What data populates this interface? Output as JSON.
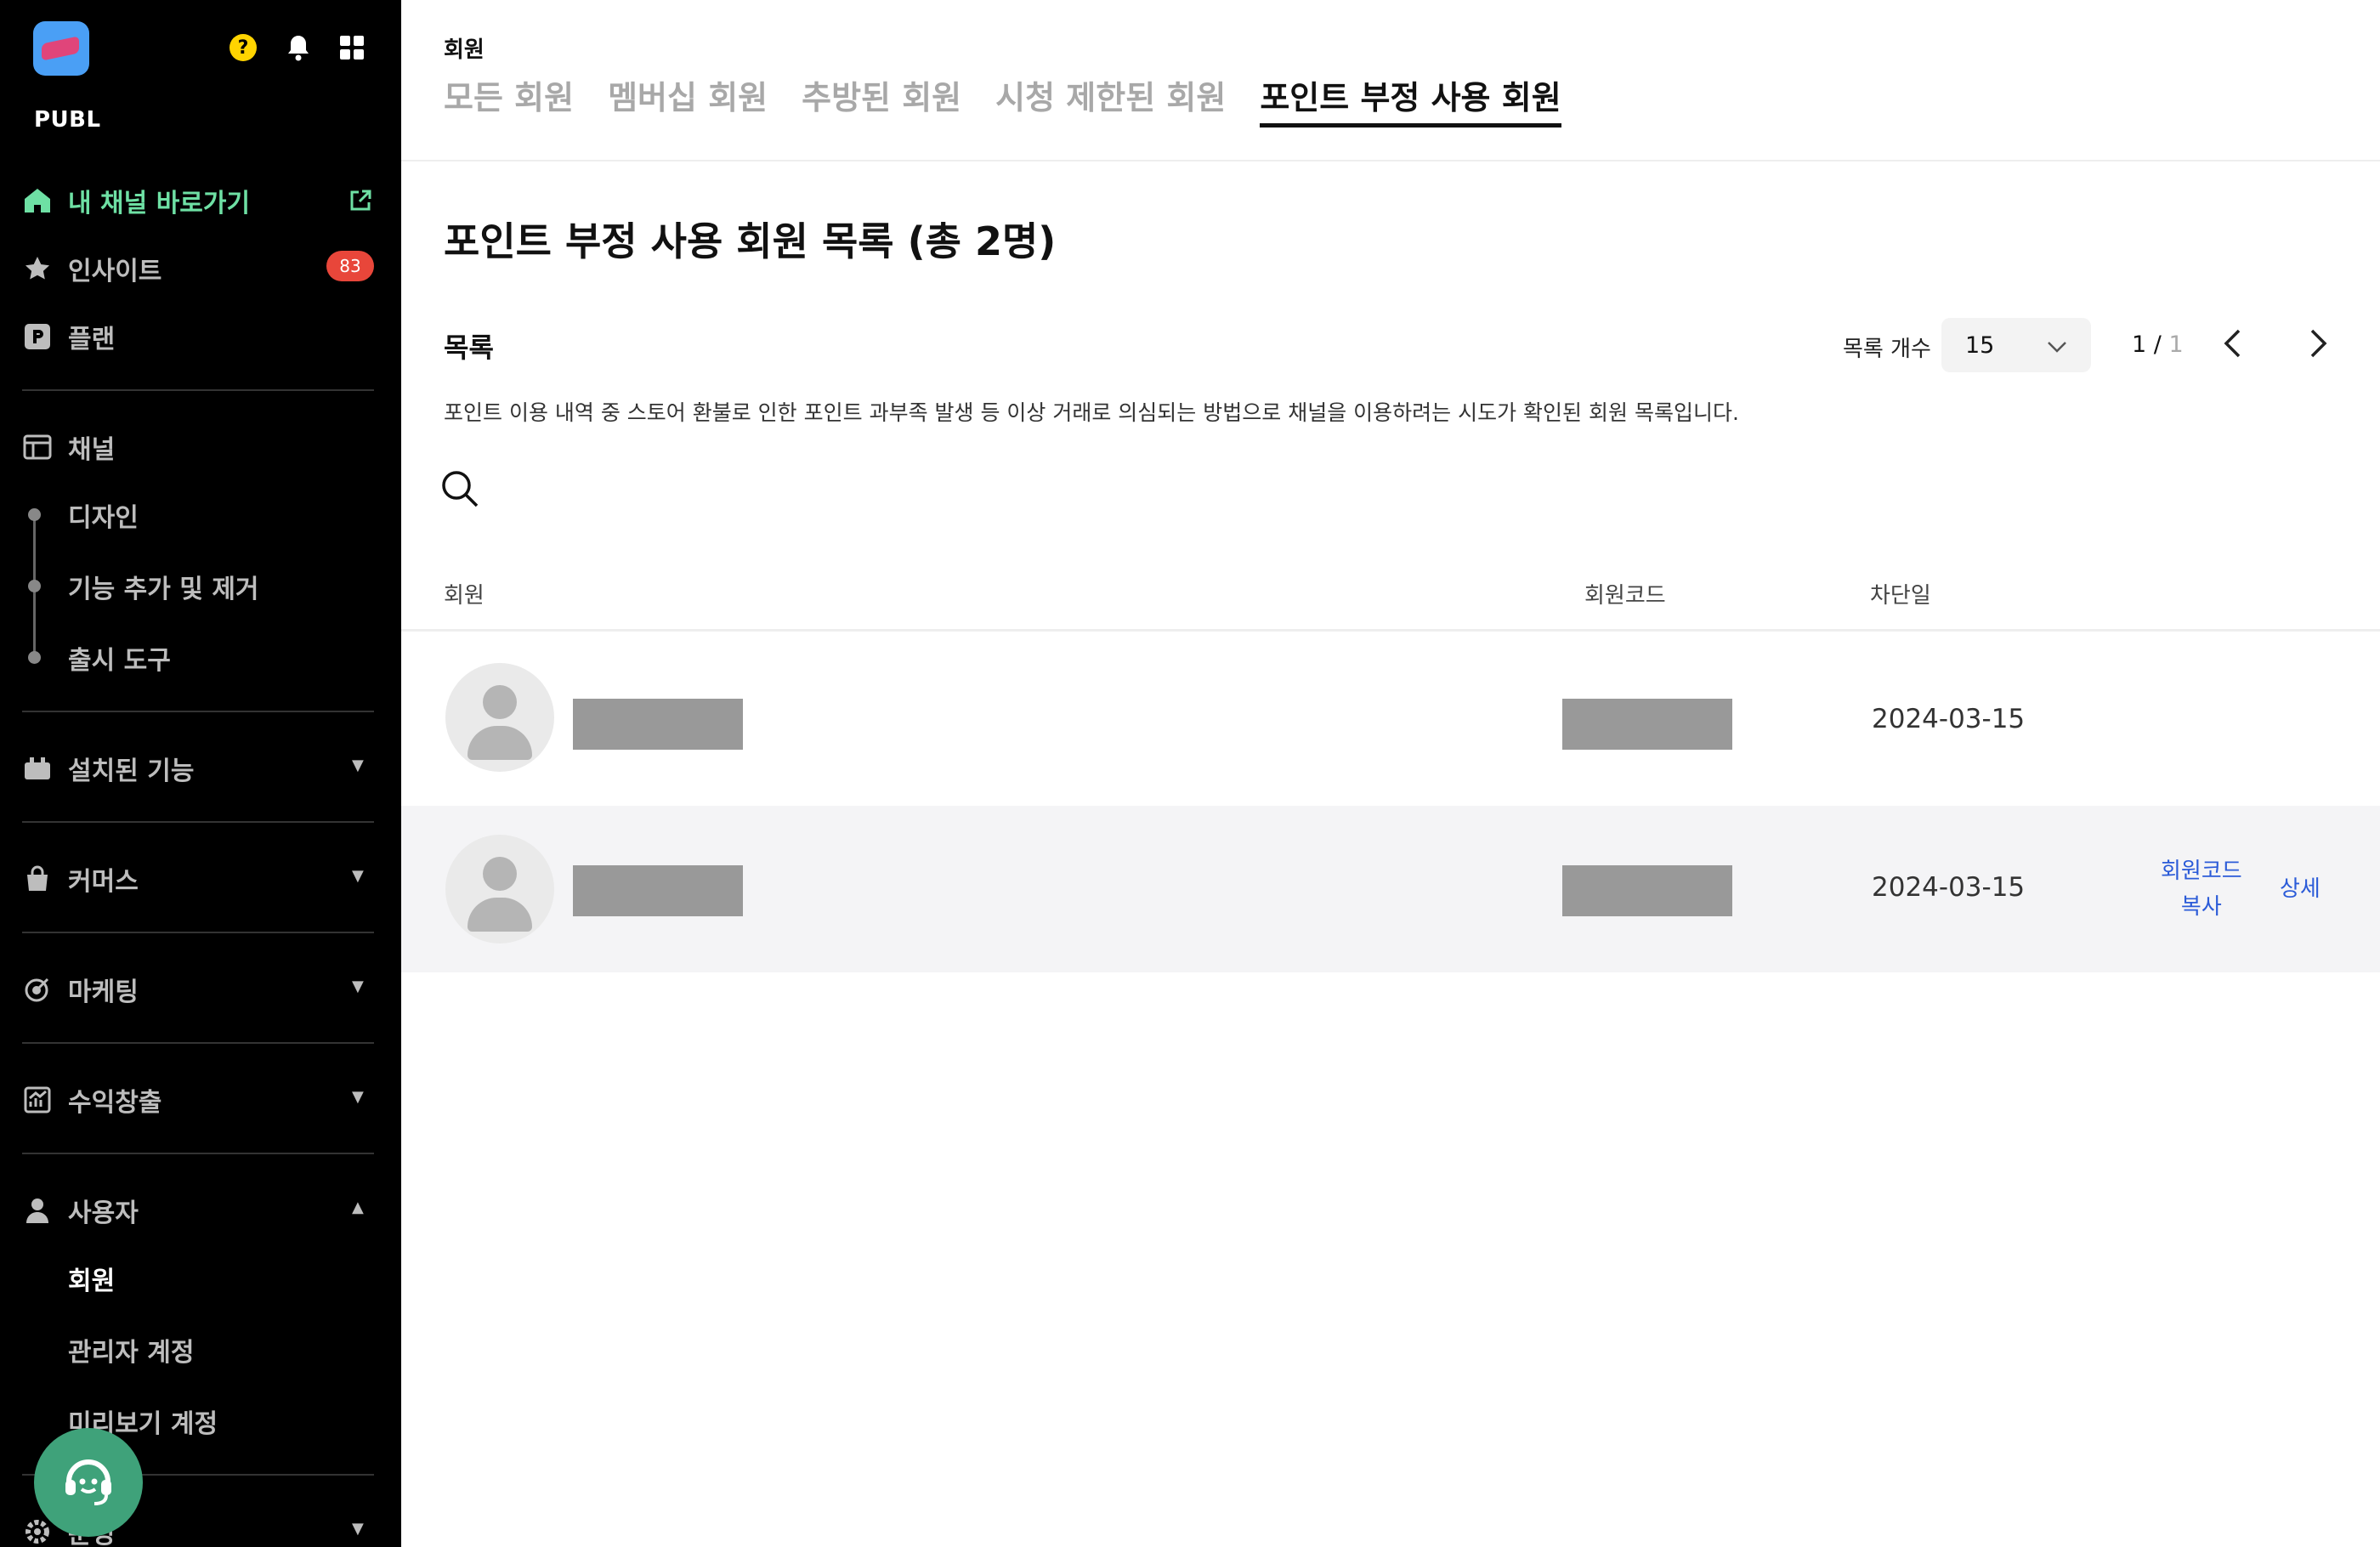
{
  "sidebar": {
    "brand": "PUBL",
    "help_glyph": "?",
    "badge_count": "83",
    "items": {
      "channel_shortcut": "내 채널 바로가기",
      "insight": "인사이트",
      "plan": "플랜",
      "channel": "채널",
      "design": "디자인",
      "feature_add_remove": "기능 추가 및 제거",
      "launch_tools": "출시 도구",
      "installed_features": "설치된 기능",
      "commerce": "커머스",
      "marketing": "마케팅",
      "monetization": "수익창출",
      "users": "사용자",
      "members": "회원",
      "admin_accounts": "관리자 계정",
      "preview_accounts": "미리보기 계정",
      "settings": "운영"
    },
    "colors": {
      "active": "#6ee0a4",
      "badge": "#e8463a",
      "support": "#3fa27a"
    }
  },
  "main": {
    "breadcrumb": "회원",
    "tabs": [
      "모든 회원",
      "멤버십 회원",
      "추방된 회원",
      "시청 제한된 회원",
      "포인트 부정 사용 회원"
    ],
    "active_tab": "포인트 부정 사용 회원",
    "page_title": "포인트 부정 사용 회원 목록 (총 2명)",
    "list_title": "목록",
    "description": "포인트 이용 내역 중 스토어 환불로 인한 포인트 과부족 발생 등 이상 거래로 의심되는 방법으로 채널을 이용하려는 시도가 확인된 회원 목록입니다.",
    "page_size_label": "목록 개수",
    "page_size_value": "15",
    "pager": {
      "current": "1",
      "separator": " / ",
      "total": "1"
    },
    "table": {
      "headers": {
        "member": "회원",
        "member_code": "회원코드",
        "blocked_date": "차단일"
      },
      "rows": [
        {
          "blocked_date": "2024-03-15"
        },
        {
          "blocked_date": "2024-03-15",
          "copy_code_line1": "회원코드",
          "copy_code_line2": "복사",
          "detail": "상세"
        }
      ]
    },
    "colors": {
      "link": "#2b5bd8",
      "row_highlight": "#f4f4f6"
    }
  }
}
